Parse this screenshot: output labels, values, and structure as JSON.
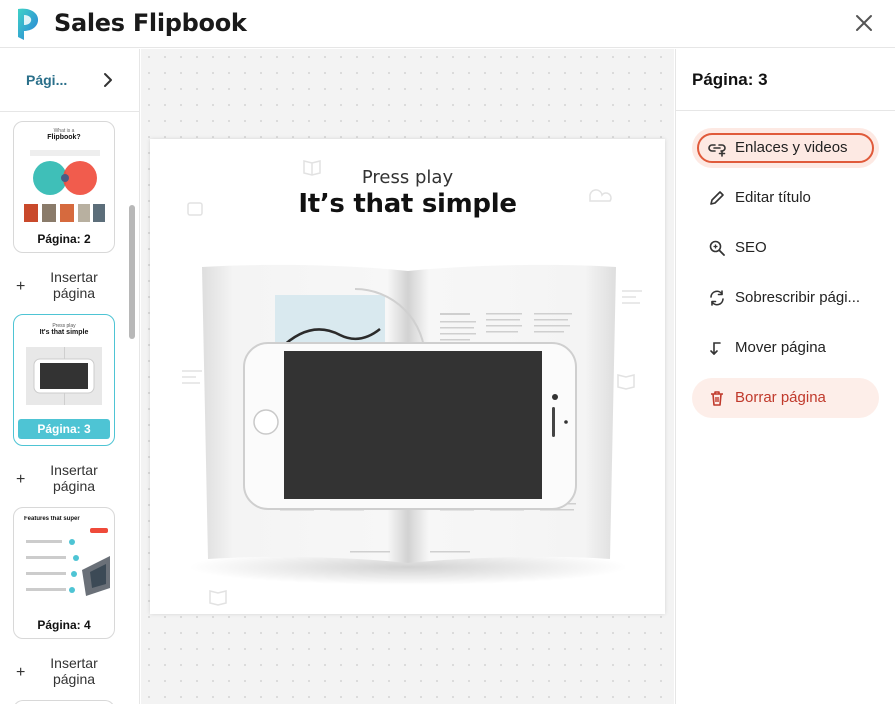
{
  "app": {
    "title": "Sales Flipbook"
  },
  "sidebar": {
    "header_label": "Pági...",
    "thumbnails": [
      {
        "label": "Página: 2",
        "title_line1": "What is a",
        "title_line2": "Flipbook?"
      },
      {
        "label": "Página: 3",
        "title_line1": "Press play",
        "title_line2": "It's that simple"
      },
      {
        "label": "Página: 4",
        "title_line1": "Features that super",
        "title_line2": ""
      }
    ],
    "insert_label": "Insertar página"
  },
  "canvas": {
    "page_subtitle": "Press play",
    "page_heading": "It’s that simple"
  },
  "panel": {
    "title": "Página: 3",
    "actions": [
      {
        "label": "Enlaces y videos",
        "icon": "link-plus-icon"
      },
      {
        "label": "Editar título",
        "icon": "pencil-icon"
      },
      {
        "label": "SEO",
        "icon": "seo-search-icon"
      },
      {
        "label": "Sobrescribir pági...",
        "icon": "replace-icon"
      },
      {
        "label": "Mover página",
        "icon": "move-icon"
      },
      {
        "label": "Borrar página",
        "icon": "trash-icon"
      }
    ]
  },
  "colors": {
    "accent": "#4ec4d4",
    "highlight_ring": "#e05a3a",
    "danger": "#c0392b",
    "sidebar_label": "#2a6f8a"
  }
}
